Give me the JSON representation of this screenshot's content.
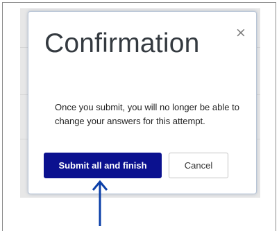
{
  "dialog": {
    "title": "Confirmation",
    "close_symbol": "×",
    "message": "Once you submit, you will no longer be able to change your answers for this attempt.",
    "primary_button": "Submit all and finish",
    "secondary_button": "Cancel"
  },
  "icons": {
    "close": "close-icon",
    "pointer": "arrow-up-icon"
  },
  "colors": {
    "primary_button_bg": "#0b118f",
    "annotation_arrow": "#0b3fa8",
    "title_text": "#343a40"
  }
}
